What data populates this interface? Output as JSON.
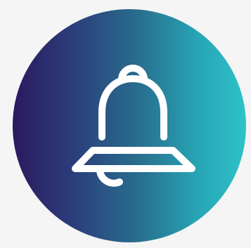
{
  "icon": {
    "name": "bell-icon",
    "stroke_color": "#ffffff"
  },
  "badge": {
    "gradient_start": "#2a1a5e",
    "gradient_end": "#2ec2c8"
  }
}
